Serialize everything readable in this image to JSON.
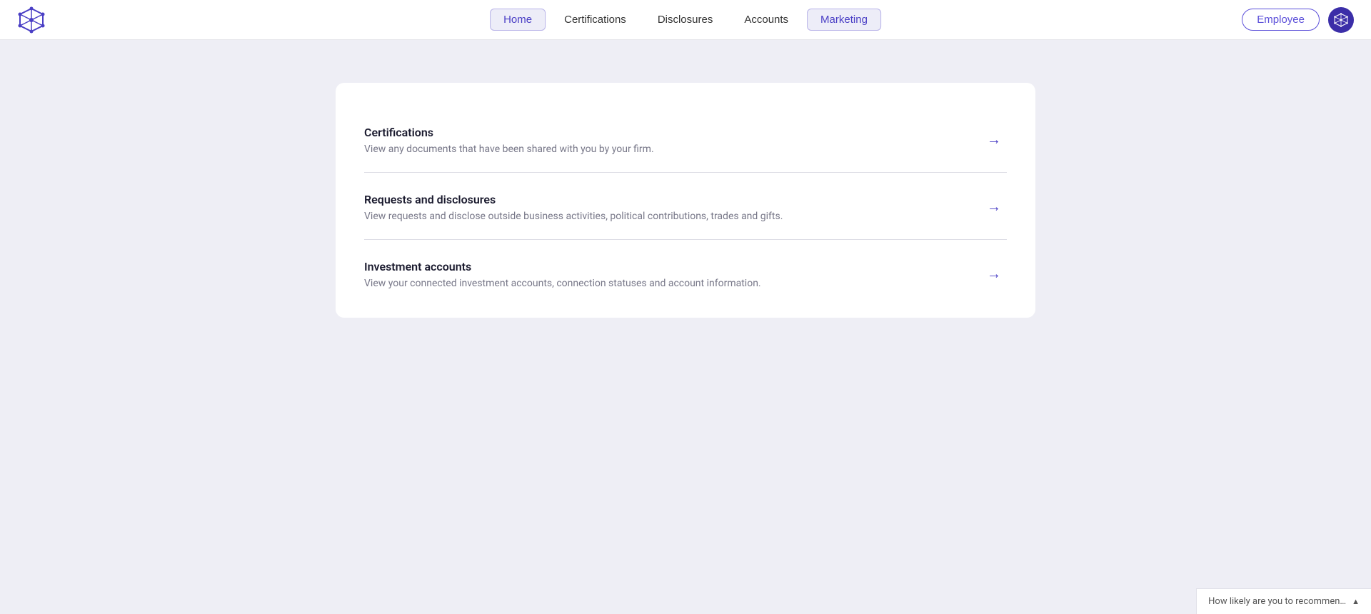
{
  "nav": {
    "logo_alt": "Company logo",
    "links": [
      {
        "label": "Home",
        "active": true
      },
      {
        "label": "Certifications",
        "active": false
      },
      {
        "label": "Disclosures",
        "active": false
      },
      {
        "label": "Accounts",
        "active": false
      },
      {
        "label": "Marketing",
        "active": false
      }
    ],
    "employee_label": "Employee",
    "avatar_alt": "User avatar"
  },
  "main": {
    "items": [
      {
        "title": "Certifications",
        "description": "View any documents that have been shared with you by your firm."
      },
      {
        "title": "Requests and disclosures",
        "description": "View requests and disclose outside business activities, political contributions, trades and gifts."
      },
      {
        "title": "Investment accounts",
        "description": "View your connected investment accounts, connection statuses and account information."
      }
    ]
  },
  "feedback": {
    "label": "How likely are you to recommen…"
  }
}
